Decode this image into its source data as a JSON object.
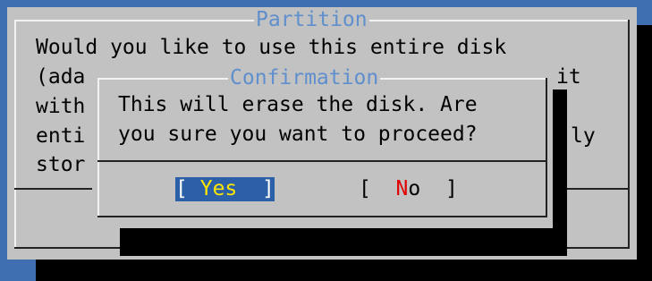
{
  "partition_dialog": {
    "title": "Partition",
    "lines": [
      "Would you like to use this entire disk",
      "(ada",
      "with",
      "enti",
      "stor"
    ],
    "right_fragments": [
      "it",
      "ly"
    ]
  },
  "confirmation_dialog": {
    "title": "Confirmation",
    "message_line1": "This will erase the disk. Are",
    "message_line2": "you sure you want to proceed?",
    "yes_button": {
      "open": "[ ",
      "hotkey": "Y",
      "rest": "es",
      "close": "  ]",
      "selected": true
    },
    "no_button": {
      "open": "[  ",
      "hotkey": "N",
      "rest": "o",
      "close": "  ]",
      "selected": false
    }
  },
  "colors": {
    "desktop": "#3f6fb0",
    "dialog": "#c2c2c2",
    "title": "#5f8fcc",
    "selected_button": "#2b5fa8",
    "selected_hotkey": "#ffe600",
    "hotkey": "#e00000"
  }
}
